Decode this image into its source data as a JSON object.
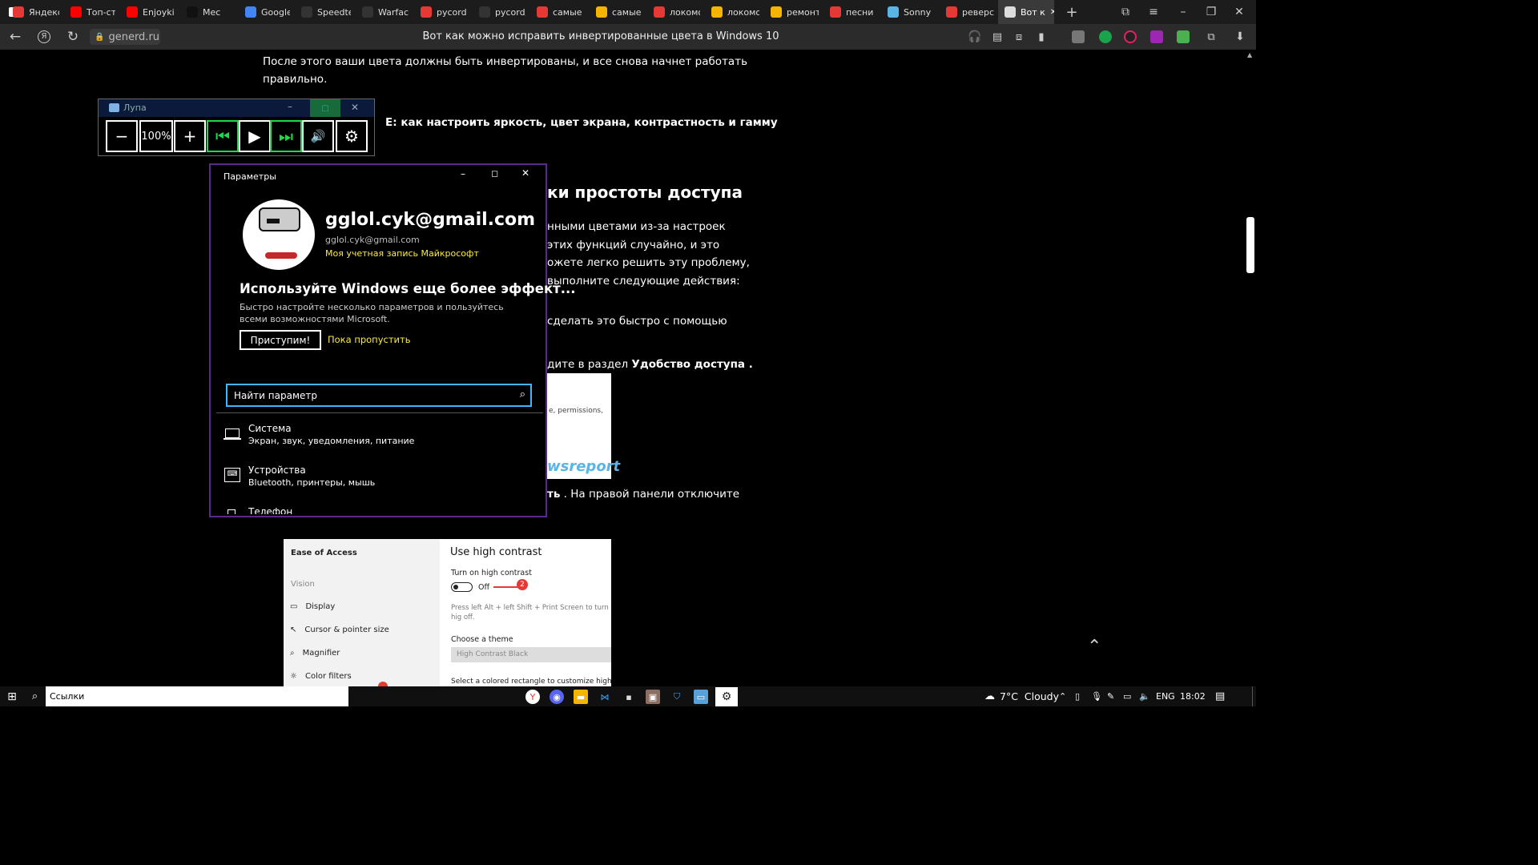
{
  "browser": {
    "tabs": [
      {
        "label": "Яндекс",
        "icon": "yandex-icon",
        "color": "#e53935"
      },
      {
        "label": "Топ-стр",
        "icon": "youtube-icon",
        "color": "#ff0000"
      },
      {
        "label": "Enjoykin",
        "icon": "youtube-icon",
        "color": "#ff0000"
      },
      {
        "label": "Мес",
        "icon": "play-icon",
        "color": "#111111"
      },
      {
        "label": "Google",
        "icon": "google-translate-icon",
        "color": "#4285f4"
      },
      {
        "label": "Speedte",
        "icon": "speedtest-icon",
        "color": "#333333"
      },
      {
        "label": "Warface",
        "icon": "stats-icon",
        "color": "#333333"
      },
      {
        "label": "pycord",
        "icon": "yandex-icon",
        "color": "#e53935"
      },
      {
        "label": "pycord/",
        "icon": "github-icon",
        "color": "#333333"
      },
      {
        "label": "самые",
        "icon": "yandex-icon",
        "color": "#e53935"
      },
      {
        "label": "самые",
        "icon": "folder-icon",
        "color": "#f4b400"
      },
      {
        "label": "локомо",
        "icon": "yandex-icon",
        "color": "#e53935"
      },
      {
        "label": "локомо",
        "icon": "folder-icon",
        "color": "#f4b400"
      },
      {
        "label": "ремонт",
        "icon": "folder-icon",
        "color": "#f4b400"
      },
      {
        "label": "песни и",
        "icon": "yandex-icon",
        "color": "#e53935"
      },
      {
        "label": "Sonny B",
        "icon": "audio-icon",
        "color": "#5ab4e6"
      },
      {
        "label": "реверс",
        "icon": "yandex-icon",
        "color": "#e53935"
      },
      {
        "label": "Вот к",
        "icon": "page-icon",
        "color": "#dddddd",
        "active": true
      }
    ],
    "url": "generd.ru",
    "page_title": "Вот как можно исправить инвертированные цвета в Windows 10"
  },
  "article": {
    "para1_line1": "После этого ваши цвета должны быть инвертированы, и все снова начнет работать",
    "para1_line2": "правильно.",
    "also_read": "Е: как настроить яркость, цвет экрана, контрастность и гамму",
    "heading": "ки простоты доступа",
    "p2_l1": "нными цветами из-за настроек",
    "p2_l2": "этих функций случайно, и это",
    "p2_l3": "ожете легко решить эту проблему,",
    "p2_l4": "выполните следующие действия:",
    "p3": "сделать это быстро с помощью",
    "p4_text": "дите в раздел",
    "p4_bold": "Удобство доступа .",
    "img_text": "e, permissions,",
    "img_brand": "wsreport",
    "p5_bold": "ть",
    "p5_text": ". На правой панели отключите"
  },
  "magnifier": {
    "title": "Лупа",
    "zoom": "100%"
  },
  "settings": {
    "title": "Параметры",
    "email_big": "gglol.cyk@gmail.com",
    "email_small": "gglol.cyk@gmail.com",
    "account_link": "Моя учетная запись Майкрософт",
    "promo_title": "Используйте Windows еще более эффект...",
    "promo_text": "Быстро настройте несколько параметров и пользуйтесь всеми возможностями Microsoft.",
    "start_btn": "Приступим!",
    "skip_link": "Пока пропустить",
    "search_placeholder": "Найти параметр",
    "categories": [
      {
        "name": "Система",
        "desc": "Экран, звук, уведомления, питание"
      },
      {
        "name": "Устройства",
        "desc": "Bluetooth, принтеры, мышь"
      },
      {
        "name": "Телефон",
        "desc": ""
      }
    ]
  },
  "ease_of_access": {
    "sidebar_title": "Ease of Access",
    "vision": "Vision",
    "items": [
      "Display",
      "Cursor & pointer size",
      "Magnifier",
      "Color filters"
    ],
    "main_title": "Use high contrast",
    "toggle_label": "Turn on high contrast",
    "toggle_state": "Off",
    "badge": "2",
    "hint": "Press left Alt + left Shift + Print Screen to turn hig off.",
    "theme_label": "Choose a theme",
    "theme_value": "High Contrast Black",
    "bottom_text": "Select a colored rectangle to customize high cont"
  },
  "taskbar": {
    "search_text": "Ссылки",
    "weather": "7°C  Cloudy",
    "lang": "ENG",
    "time": "18:02"
  },
  "colors": {
    "accent_green": "#1fd94b",
    "settings_border": "#5a2a8a",
    "link_yellow": "#ffeb3b",
    "search_border": "#3fb6ff"
  }
}
